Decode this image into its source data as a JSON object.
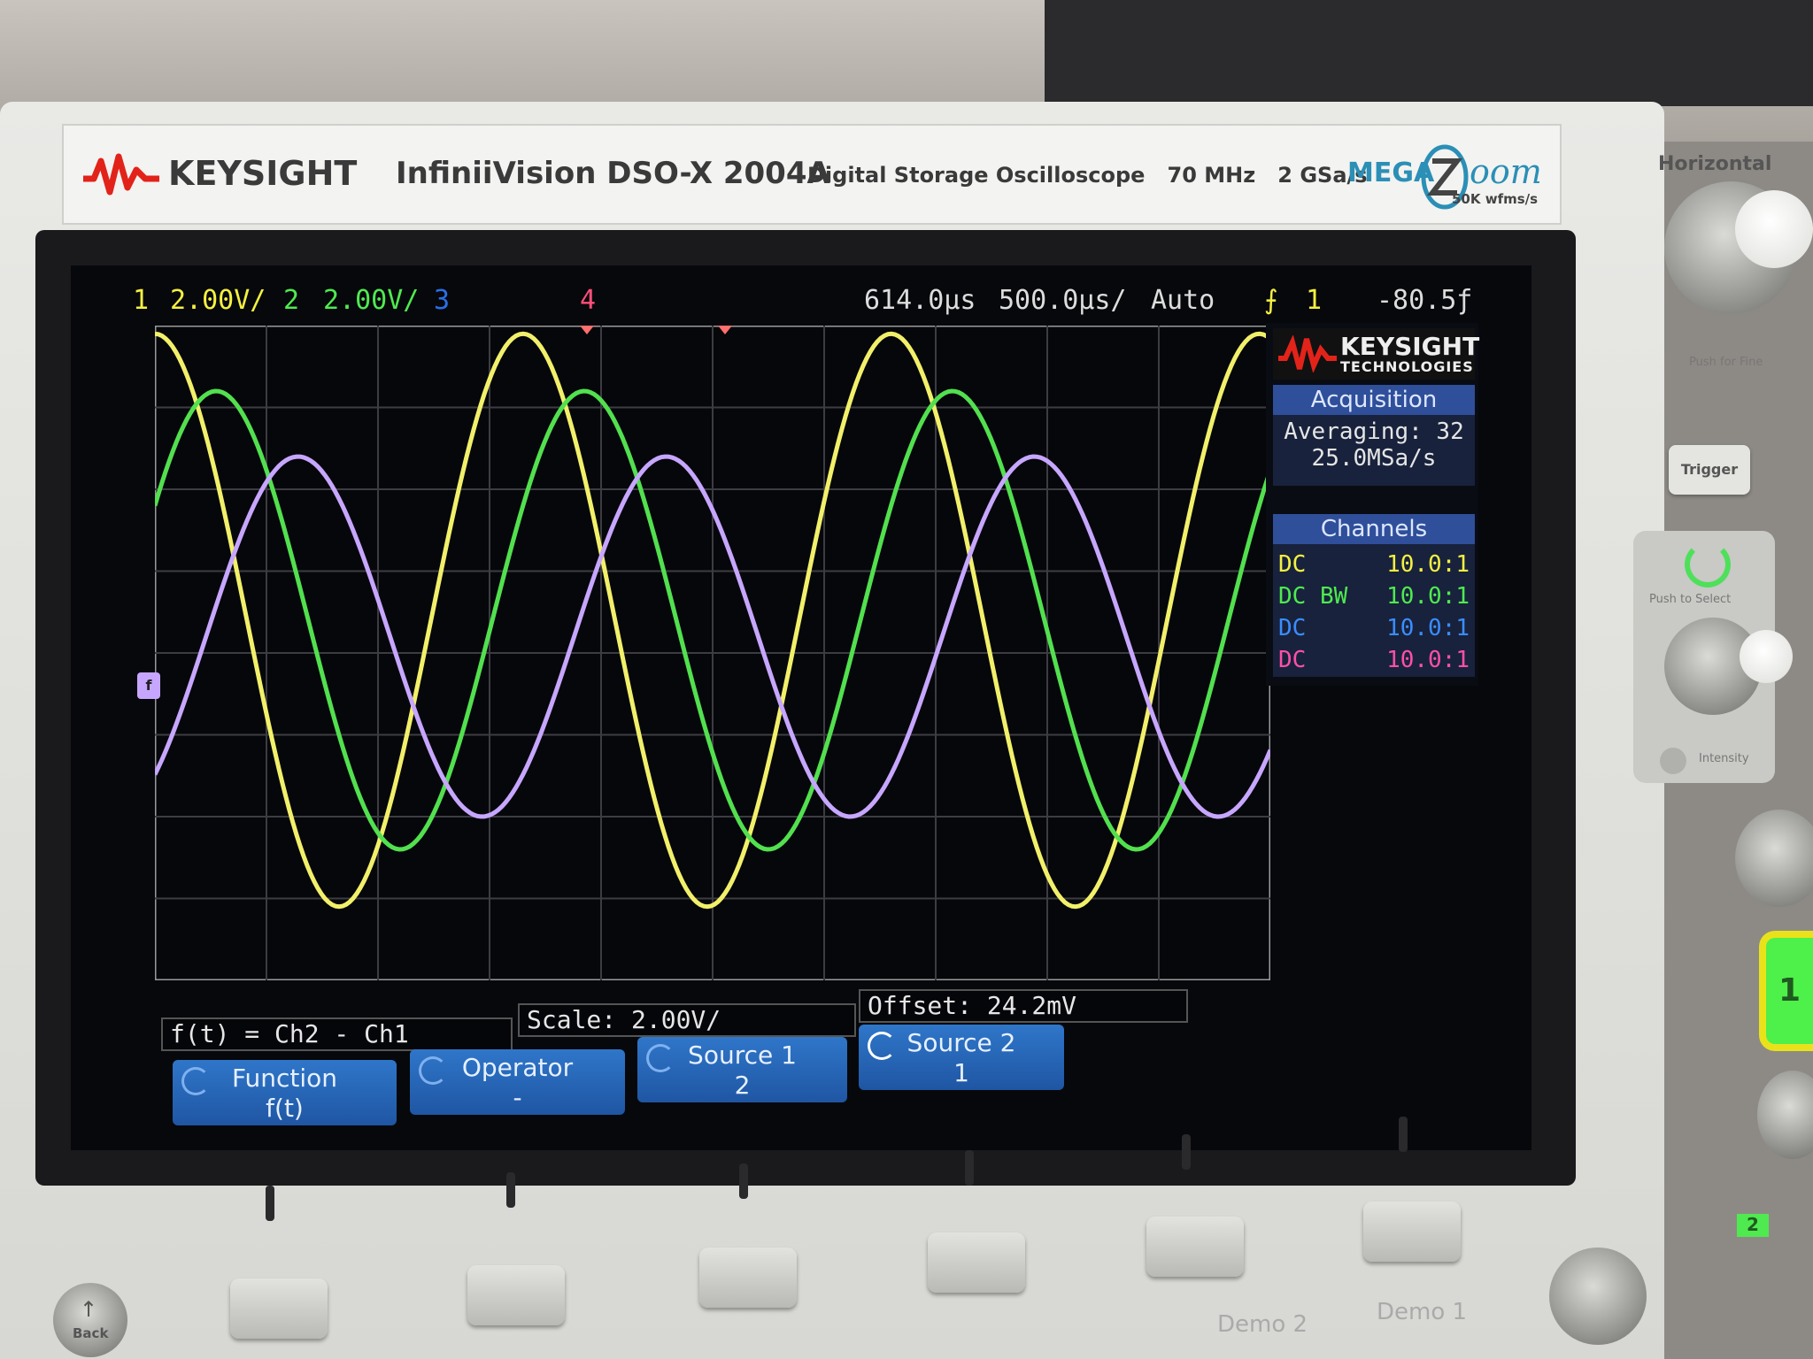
{
  "header": {
    "brand": "KEYSIGHT",
    "model": "InfiniiVision DSO-X 2004A",
    "description": "Digital Storage Oscilloscope",
    "bandwidth": "70 MHz",
    "sample_rate": "2 GSa/s",
    "megazoom": "MEGA",
    "megazoom_suffix": "oom",
    "megazoom_sub": "50K wfms/s"
  },
  "topbar": {
    "ch1_num": "1",
    "ch1_scale": "2.00V/",
    "ch2_num": "2",
    "ch2_scale": "2.00V/",
    "ch3_num": "3",
    "ch4_num": "4",
    "time_offset": "614.0µs",
    "time_scale": "500.0µs/",
    "trigger_mode": "Auto",
    "trigger_source": "1",
    "trigger_level": "-80.5ƒ"
  },
  "panel": {
    "logo_line1": "KEYSIGHT",
    "logo_line2": "TECHNOLOGIES",
    "acquisition_title": "Acquisition",
    "averaging": "Averaging: 32",
    "rate": "25.0MSa/s",
    "channels_title": "Channels",
    "channels": [
      {
        "coupling": "DC",
        "probe": "10.0:1",
        "color": "#f4f040"
      },
      {
        "coupling": "DC BW",
        "probe": "10.0:1",
        "color": "#4fea4f"
      },
      {
        "coupling": "DC",
        "probe": "10.0:1",
        "color": "#3a8dff"
      },
      {
        "coupling": "DC",
        "probe": "10.0:1",
        "color": "#ff4fa8"
      }
    ]
  },
  "math": {
    "function_expr": "f(t) = Ch2 - Ch1",
    "scale": "Scale: 2.00V/",
    "offset": "Offset: 24.2mV"
  },
  "softkeys": [
    {
      "label": "Function",
      "value": "f(t)"
    },
    {
      "label": "Operator",
      "value": "-"
    },
    {
      "label": "Source 1",
      "value": "2"
    },
    {
      "label": "Source 2",
      "value": "1"
    }
  ],
  "waveforms": {
    "grid_divisions": {
      "horizontal": 10,
      "vertical": 8
    },
    "traces": [
      {
        "name": "ch1",
        "color": "#f2f06a",
        "amplitude_div": 3.5,
        "center_div": 0.4,
        "period_div": 3.3,
        "phase_deg": 90
      },
      {
        "name": "ch2",
        "color": "#52e04f",
        "amplitude_div": 2.8,
        "center_div": 0.4,
        "period_div": 3.3,
        "phase_deg": 30
      },
      {
        "name": "math",
        "color": "#c7a6ff",
        "amplitude_div": 2.2,
        "center_div": 0.2,
        "period_div": 3.3,
        "phase_deg": -50
      }
    ]
  },
  "front_panel": {
    "horizontal": "Horizontal",
    "push_for_fine": "Push for Fine",
    "trigger": "Trigger",
    "push_to_select": "Push to Select",
    "intensity": "Intensity",
    "back": "Back",
    "demo2": "Demo 2",
    "demo1": "Demo 1",
    "ch1_button": "1",
    "ch2_label": "2"
  }
}
